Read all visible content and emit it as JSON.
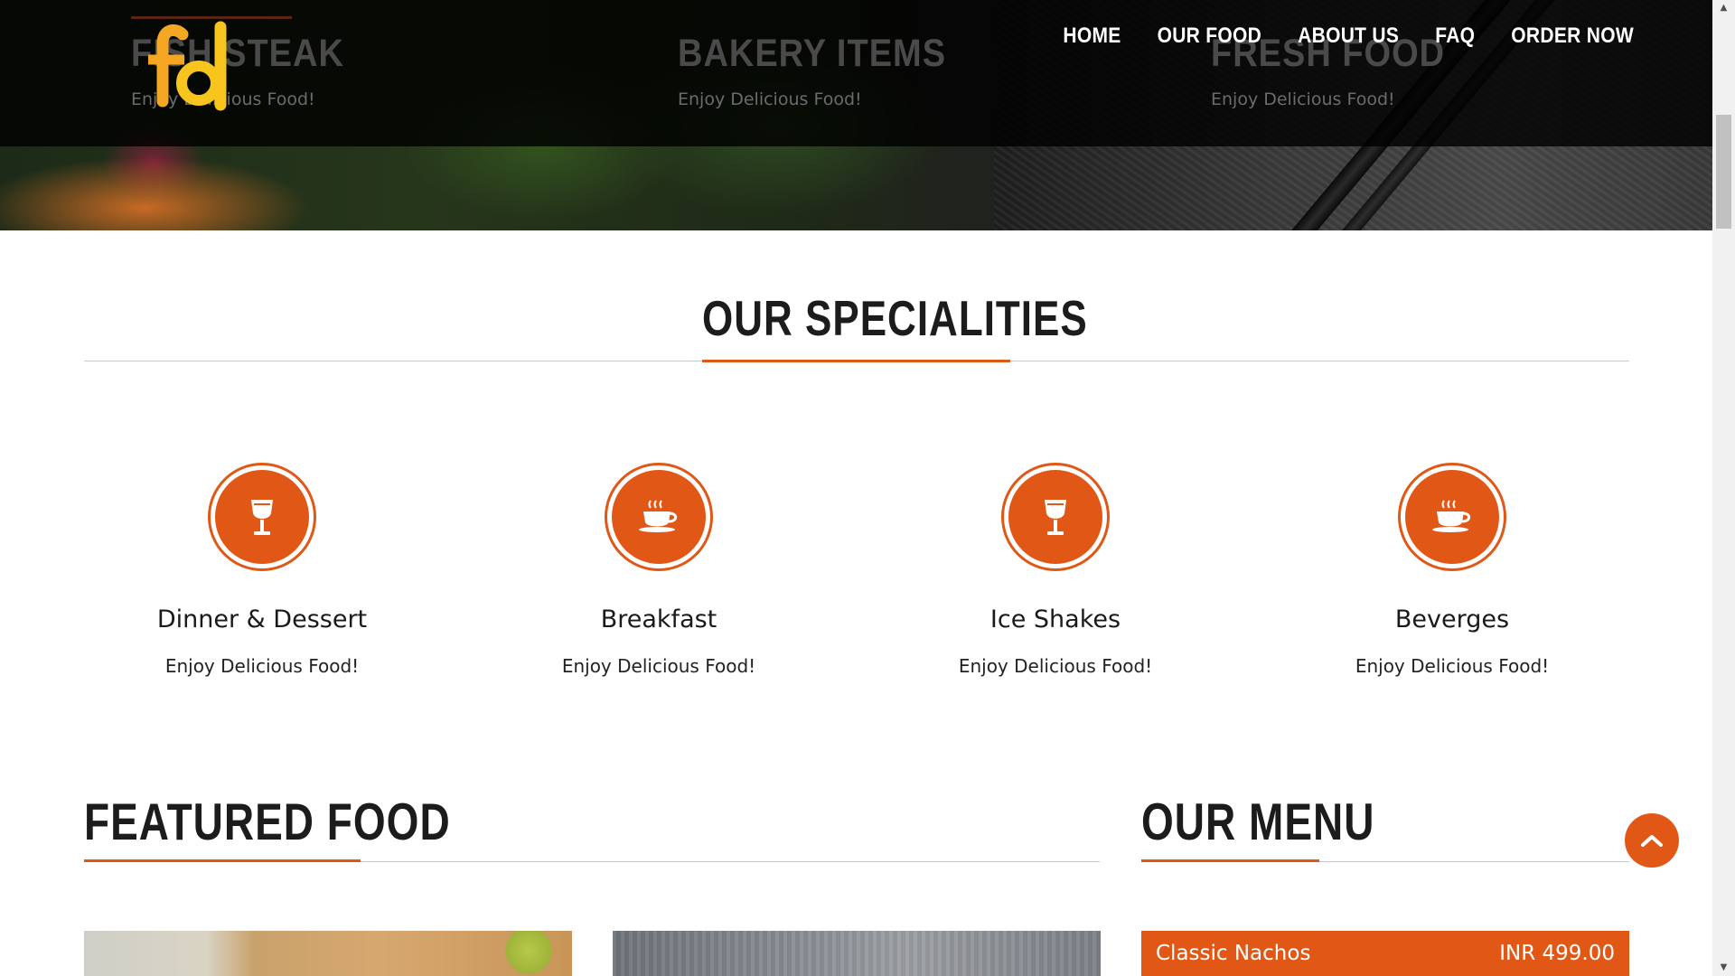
{
  "hero": {
    "slides": [
      {
        "title": "FISH STEAK",
        "subtitle": "Enjoy Delicious Food!"
      },
      {
        "title": "BAKERY ITEMS",
        "subtitle": "Enjoy Delicious Food!"
      },
      {
        "title": "FRESH FOOD",
        "subtitle": "Enjoy Delicious Food!"
      }
    ]
  },
  "logo": {
    "text": "fd",
    "icon": "fd-logo",
    "colors": [
      "#f5a623",
      "#f7c51e"
    ]
  },
  "nav": {
    "items": [
      {
        "label": "HOME"
      },
      {
        "label": "OUR FOOD"
      },
      {
        "label": "ABOUT US"
      },
      {
        "label": "FAQ"
      },
      {
        "label": "ORDER NOW"
      }
    ]
  },
  "specialities": {
    "heading": "OUR SPECIALITIES",
    "items": [
      {
        "title": "Dinner & Dessert",
        "subtitle": "Enjoy Delicious Food!",
        "icon": "wine-glass-icon"
      },
      {
        "title": "Breakfast",
        "subtitle": "Enjoy Delicious Food!",
        "icon": "coffee-cup-icon"
      },
      {
        "title": "Ice Shakes",
        "subtitle": "Enjoy Delicious Food!",
        "icon": "wine-glass-icon"
      },
      {
        "title": "Beverges",
        "subtitle": "Enjoy Delicious Food!",
        "icon": "coffee-cup-icon"
      }
    ]
  },
  "featured": {
    "heading": "FEATURED FOOD"
  },
  "menu": {
    "heading": "OUR MENU",
    "items": [
      {
        "name": "Classic Nachos",
        "price": "INR 499.00"
      }
    ]
  },
  "colors": {
    "accent": "#e05716",
    "heading": "#1c1c1c",
    "nav_text": "#ffffff"
  }
}
